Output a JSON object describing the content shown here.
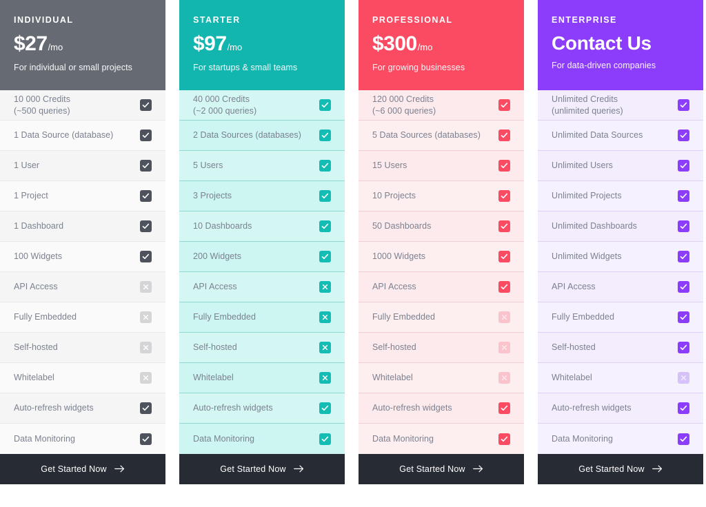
{
  "cta_label": "Get Started Now",
  "cta_icon": "arrow-right-icon",
  "icons": {
    "included": "checkbox-checked-icon",
    "excluded": "checkbox-cross-icon"
  },
  "plans": [
    {
      "id": "individual",
      "name": "INDIVIDUAL",
      "price": "$27",
      "period": "/mo",
      "tagline": "For individual or small projects",
      "header_bg": "#666a73",
      "row_bg_a": "#f5f5f5",
      "row_bg_b": "#fafafa",
      "row_border": "#e8e8e8",
      "accent": "#4e525c",
      "muted_accent": "#d5d5d7",
      "muted_glyph": "#ffffff",
      "features": [
        {
          "label": "10 000 Credits",
          "sub": "(~500 queries)",
          "state": "included"
        },
        {
          "label": "1 Data Source (database)",
          "sub": "",
          "state": "included"
        },
        {
          "label": "1 User",
          "sub": "",
          "state": "included"
        },
        {
          "label": "1 Project",
          "sub": "",
          "state": "included"
        },
        {
          "label": "1 Dashboard",
          "sub": "",
          "state": "included"
        },
        {
          "label": "100 Widgets",
          "sub": "",
          "state": "included"
        },
        {
          "label": "API Access",
          "sub": "",
          "state": "excluded"
        },
        {
          "label": "Fully Embedded",
          "sub": "",
          "state": "excluded"
        },
        {
          "label": "Self-hosted",
          "sub": "",
          "state": "excluded"
        },
        {
          "label": "Whitelabel",
          "sub": "",
          "state": "excluded"
        },
        {
          "label": "Auto-refresh widgets",
          "sub": "",
          "state": "included"
        },
        {
          "label": "Data Monitoring",
          "sub": "",
          "state": "included"
        }
      ]
    },
    {
      "id": "starter",
      "name": "STARTER",
      "price": "$97",
      "period": "/mo",
      "tagline": "For startups & small teams",
      "header_bg": "#12b6ae",
      "row_bg_a": "#d4f7f3",
      "row_bg_b": "#cdf5f1",
      "row_border": "#8fd9d2",
      "accent": "#13bdb4",
      "muted_accent": "#13bdb4",
      "muted_glyph": "#ffffff",
      "features": [
        {
          "label": "40 000 Credits",
          "sub": "(~2 000 queries)",
          "state": "included"
        },
        {
          "label": "2 Data Sources (databases)",
          "sub": "",
          "state": "included"
        },
        {
          "label": "5 Users",
          "sub": "",
          "state": "included"
        },
        {
          "label": "3 Projects",
          "sub": "",
          "state": "included"
        },
        {
          "label": "10 Dashboards",
          "sub": "",
          "state": "included"
        },
        {
          "label": "200 Widgets",
          "sub": "",
          "state": "included"
        },
        {
          "label": "API Access",
          "sub": "",
          "state": "excluded"
        },
        {
          "label": "Fully Embedded",
          "sub": "",
          "state": "excluded"
        },
        {
          "label": "Self-hosted",
          "sub": "",
          "state": "excluded"
        },
        {
          "label": "Whitelabel",
          "sub": "",
          "state": "excluded"
        },
        {
          "label": "Auto-refresh widgets",
          "sub": "",
          "state": "included"
        },
        {
          "label": "Data Monitoring",
          "sub": "",
          "state": "included"
        }
      ]
    },
    {
      "id": "professional",
      "name": "PROFESSIONAL",
      "price": "$300",
      "period": "/mo",
      "tagline": "For growing businesses",
      "header_bg": "#fb4b63",
      "row_bg_a": "#fdeaed",
      "row_bg_b": "#fdeef0",
      "row_border": "#f8ccd4",
      "accent": "#fb4b63",
      "muted_accent": "#fbc3cc",
      "muted_glyph": "#fdeaed",
      "features": [
        {
          "label": "120 000 Credits",
          "sub": "(~6 000 queries)",
          "state": "included"
        },
        {
          "label": "5 Data Sources (databases)",
          "sub": "",
          "state": "included"
        },
        {
          "label": "15 Users",
          "sub": "",
          "state": "included"
        },
        {
          "label": "10 Projects",
          "sub": "",
          "state": "included"
        },
        {
          "label": "50 Dashboards",
          "sub": "",
          "state": "included"
        },
        {
          "label": "1000 Widgets",
          "sub": "",
          "state": "included"
        },
        {
          "label": "API Access",
          "sub": "",
          "state": "included"
        },
        {
          "label": "Fully Embedded",
          "sub": "",
          "state": "excluded"
        },
        {
          "label": "Self-hosted",
          "sub": "",
          "state": "excluded"
        },
        {
          "label": "Whitelabel",
          "sub": "",
          "state": "excluded"
        },
        {
          "label": "Auto-refresh widgets",
          "sub": "",
          "state": "included"
        },
        {
          "label": "Data Monitoring",
          "sub": "",
          "state": "included"
        }
      ]
    },
    {
      "id": "enterprise",
      "name": "ENTERPRISE",
      "price": "Contact Us",
      "period": "",
      "tagline": "For data-driven companies",
      "header_bg": "#8b3dfb",
      "row_bg_a": "#f3edfe",
      "row_bg_b": "#f6f1fe",
      "row_border": "#ddd0fa",
      "accent": "#8b3dfb",
      "muted_accent": "#d5c2fb",
      "muted_glyph": "#f3edfe",
      "features": [
        {
          "label": "Unlimited Credits",
          "sub": "(unlimited queries)",
          "state": "included"
        },
        {
          "label": "Unlimited Data Sources",
          "sub": "",
          "state": "included"
        },
        {
          "label": "Unlimited Users",
          "sub": "",
          "state": "included"
        },
        {
          "label": "Unlimited Projects",
          "sub": "",
          "state": "included"
        },
        {
          "label": "Unlimited Dashboards",
          "sub": "",
          "state": "included"
        },
        {
          "label": "Unlimited Widgets",
          "sub": "",
          "state": "included"
        },
        {
          "label": "API Access",
          "sub": "",
          "state": "included"
        },
        {
          "label": "Fully Embedded",
          "sub": "",
          "state": "included"
        },
        {
          "label": "Self-hosted",
          "sub": "",
          "state": "included"
        },
        {
          "label": "Whitelabel",
          "sub": "",
          "state": "excluded"
        },
        {
          "label": "Auto-refresh widgets",
          "sub": "",
          "state": "included"
        },
        {
          "label": "Data Monitoring",
          "sub": "",
          "state": "included"
        }
      ]
    }
  ]
}
